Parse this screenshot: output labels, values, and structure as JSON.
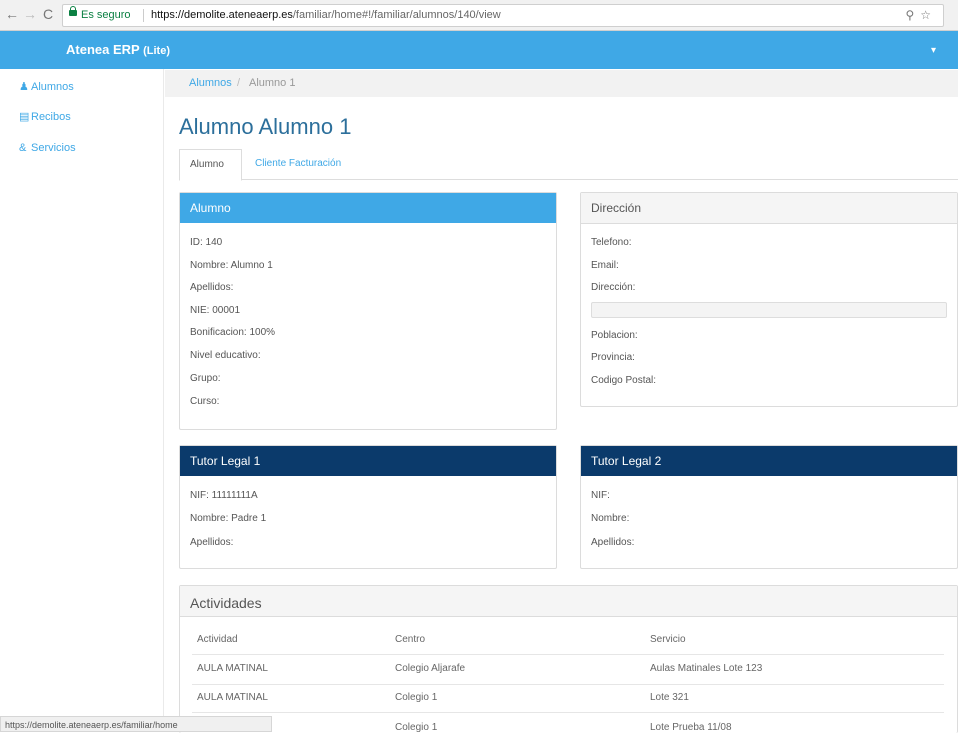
{
  "browser": {
    "secure_label": "Es seguro",
    "url_host": "https://demolite.ateneaerp.es",
    "url_path": "/familiar/home#!/familiar/alumnos/140/view",
    "status_url": "https://demolite.ateneaerp.es/familiar/home"
  },
  "topbar": {
    "brand": "Atenea ERP",
    "brand_suffix": "(Lite)"
  },
  "sidebar": {
    "items": [
      {
        "label": "Alumnos",
        "icon": "user-icon"
      },
      {
        "label": "Recibos",
        "icon": "receipt-icon"
      },
      {
        "label": "Servicios",
        "icon": "services-icon"
      }
    ]
  },
  "breadcrumb": {
    "link": "Alumnos",
    "separator": "/",
    "current": "Alumno 1"
  },
  "page_title": "Alumno Alumno 1",
  "tabs": [
    {
      "label": "Alumno",
      "active": true
    },
    {
      "label": "Cliente Facturación",
      "active": false
    }
  ],
  "alumno": {
    "title": "Alumno",
    "rows": [
      "ID: 140",
      "Nombre: Alumno 1",
      "Apellidos:",
      "NIE: 00001",
      "Bonificacion: 100%",
      "Nivel educativo:",
      "Grupo:",
      "Curso:"
    ]
  },
  "direccion": {
    "title": "Dirección",
    "rows": [
      "Telefono:",
      "Email:",
      "Dirección:",
      "Poblacion:",
      "Provincia:",
      "Codigo Postal:"
    ]
  },
  "tutor1": {
    "title": "Tutor Legal 1",
    "rows": [
      "NIF: 11111111A",
      "Nombre: Padre 1",
      "Apellidos:"
    ]
  },
  "tutor2": {
    "title": "Tutor Legal 2",
    "rows": [
      "NIF:",
      "Nombre:",
      "Apellidos:"
    ]
  },
  "actividades": {
    "title": "Actividades",
    "columns": [
      "Actividad",
      "Centro",
      "Servicio"
    ],
    "rows": [
      [
        "AULA MATINAL",
        "Colegio Aljarafe",
        "Aulas Matinales Lote 123"
      ],
      [
        "AULA MATINAL",
        "Colegio 1",
        "Lote 321"
      ],
      [
        "",
        "Colegio 1",
        "Lote Prueba 11/08"
      ]
    ]
  },
  "colors": {
    "accent": "#3fa8e6",
    "navy": "#0b3a6b",
    "title": "#2c6f9b"
  }
}
